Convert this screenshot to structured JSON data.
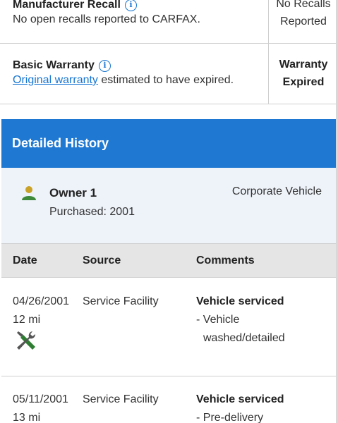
{
  "summary": {
    "recall": {
      "title": "Manufacturer Recall",
      "description": "No open recalls reported to CARFAX.",
      "status_line1": "No Recalls",
      "status_line2": "Reported"
    },
    "warranty": {
      "title": "Basic Warranty",
      "link_text": "Original warranty",
      "description_rest": " estimated to have expired.",
      "status_line1": "Warranty",
      "status_line2": "Expired"
    }
  },
  "history": {
    "title": "Detailed History",
    "owner": {
      "name": "Owner 1",
      "type": "Corporate Vehicle",
      "purchased": "Purchased: 2001"
    },
    "columns": {
      "date": "Date",
      "source": "Source",
      "comments": "Comments"
    },
    "records": [
      {
        "date": "04/26/2001",
        "mileage": "12 mi",
        "source": "Service Facility",
        "comment_title": "Vehicle serviced",
        "comment_line1": "- Vehicle",
        "comment_line2": "washed/detailed"
      },
      {
        "date": "05/11/2001",
        "mileage": "13 mi",
        "source": "Service Facility",
        "comment_title": "Vehicle serviced",
        "comment_line1": "- Pre-delivery"
      }
    ]
  },
  "icons": {
    "info": "info-icon",
    "person": "person-icon",
    "service": "wrench-screwdriver-icon"
  },
  "colors": {
    "accent": "#1f78d1",
    "link": "#1976d2",
    "owner_icon": "#3f8a3a",
    "tools_icon": "#2e7d32"
  }
}
